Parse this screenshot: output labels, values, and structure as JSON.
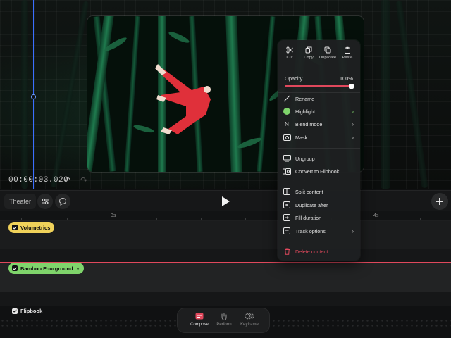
{
  "stage": {
    "timecode": "00:00:03.020"
  },
  "toolbar": {
    "theater_label": "Theater"
  },
  "ruler": {
    "labels": [
      "3s",
      "4s"
    ]
  },
  "tracks": {
    "volumetrics": "Volumetrics",
    "bamboo": "Bamboo Fourground",
    "flipbook": "Flipbook"
  },
  "modes": {
    "compose": "Compose",
    "perform": "Perform",
    "keyframe": "Keyframe",
    "active": "Compose"
  },
  "menu": {
    "clipboard": [
      "Cut",
      "Copy",
      "Duplicate",
      "Paste"
    ],
    "opacity_label": "Opacity",
    "opacity_value": "100%",
    "opacity_fraction": 1.0,
    "rename": "Rename",
    "highlight": "Highlight",
    "blend_mode": "Blend mode",
    "blend_mode_glyph": "N",
    "mask": "Mask",
    "ungroup": "Ungroup",
    "convert_flipbook": "Convert to Flipbook",
    "split_content": "Split content",
    "duplicate_after": "Duplicate after",
    "fill_duration": "Fill duration",
    "track_options": "Track options",
    "delete_content": "Delete content"
  },
  "colors": {
    "accent_red": "#e0485c",
    "highlight_green": "#7fd46b",
    "volumetrics_yellow": "#f0d25a",
    "playhead_blue": "#3a6fff"
  },
  "icons": {
    "cut": "scissors-icon",
    "copy": "copy-icon",
    "duplicate": "duplicate-icon",
    "paste": "paste-icon",
    "rename": "pencil-icon",
    "mask": "mask-icon",
    "ungroup": "ungroup-icon",
    "convert": "flipbook-icon",
    "split": "split-icon",
    "dup_after": "duplicate-after-icon",
    "fill": "fill-duration-icon",
    "track_options": "track-options-icon",
    "delete": "trash-icon",
    "undo": "undo-icon",
    "redo": "redo-icon",
    "play": "play-icon",
    "add": "plus-icon"
  }
}
